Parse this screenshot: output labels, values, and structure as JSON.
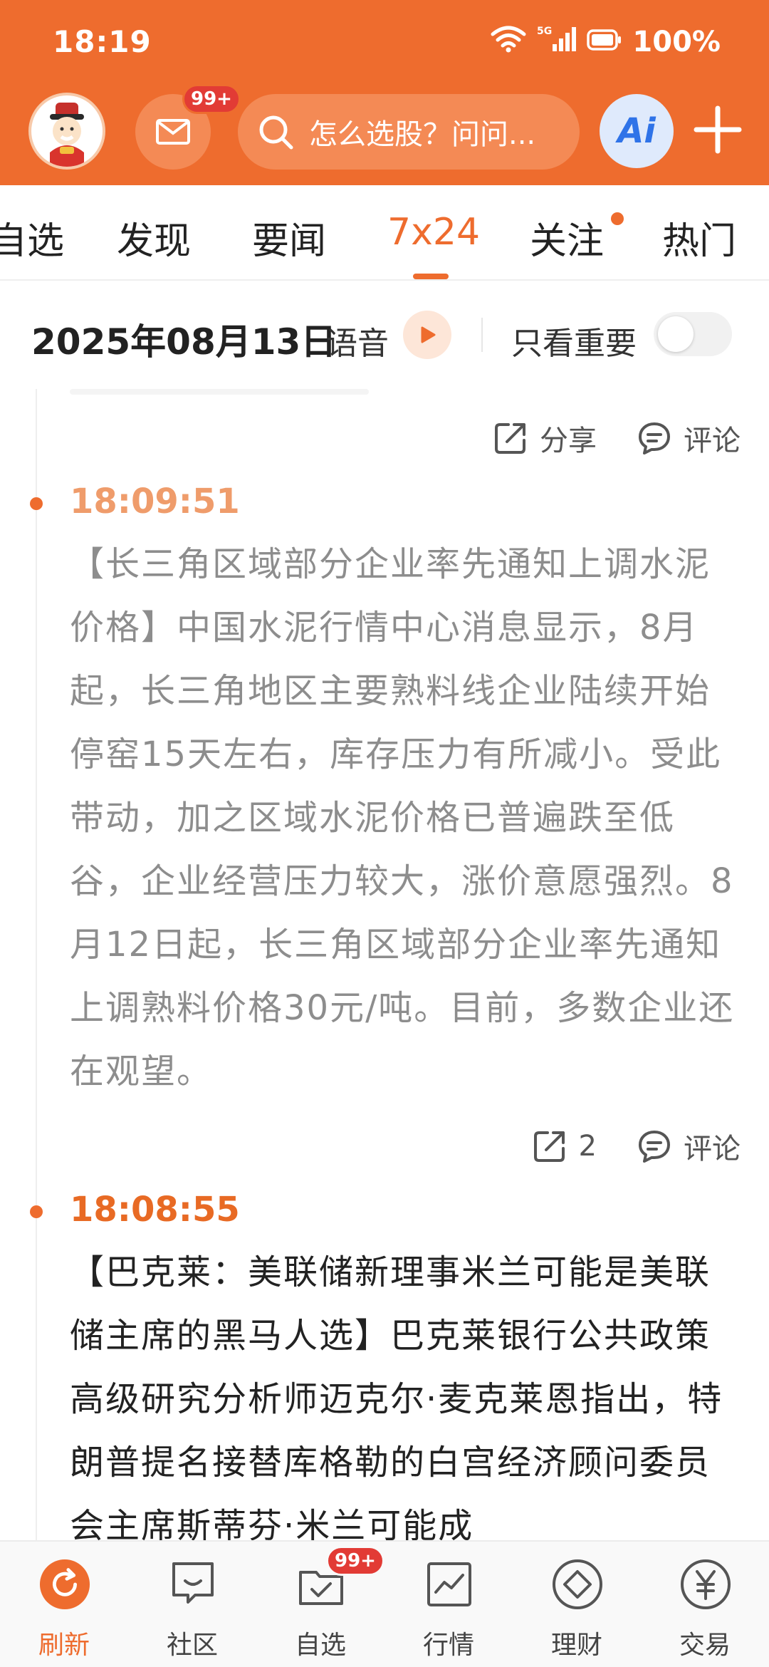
{
  "status_bar": {
    "time": "18:19",
    "network": "5G",
    "battery": "100%"
  },
  "header": {
    "mail_badge": "99+",
    "search_placeholder": "怎么选股？问问...",
    "ai_label": "Ai"
  },
  "tabs": [
    {
      "label": "自选",
      "active": false
    },
    {
      "label": "发现",
      "active": false
    },
    {
      "label": "要闻",
      "active": false
    },
    {
      "label": "7x24",
      "active": true
    },
    {
      "label": "关注",
      "active": false,
      "dot": true
    },
    {
      "label": "热门",
      "active": false
    }
  ],
  "date_row": {
    "date": "2025年08月13日",
    "voice_label": "语音",
    "important_label": "只看重要",
    "important_on": false
  },
  "feed": {
    "top_actions": {
      "share": "分享",
      "comment": "评论"
    },
    "items": [
      {
        "time": "18:09:51",
        "text": "【长三角区域部分企业率先通知上调水泥价格】中国水泥行情中心消息显示，8月起，长三角地区主要熟料线企业陆续开始停窑15天左右，库存压力有所减小。受此带动，加之区域水泥价格已普遍跌至低谷，企业经营压力较大，涨价意愿强烈。8月12日起，长三角区域部分企业率先通知上调熟料价格30元/吨。目前，多数企业还在观望。",
        "share_count": "2",
        "comment": "评论"
      },
      {
        "time": "18:08:55",
        "text": "【巴克莱：美联储新理事米兰可能是美联储主席的黑马人选】巴克莱银行公共政策高级研究分析师迈克尔·麦克莱恩指出，特朗普提名接替库格勒的白宫经济顾问委员会主席斯蒂芬·米兰可能成"
      }
    ]
  },
  "bottom_nav": [
    {
      "label": "刷新",
      "icon": "refresh-icon",
      "active": true
    },
    {
      "label": "社区",
      "icon": "chat-icon",
      "active": false
    },
    {
      "label": "自选",
      "icon": "watchlist-icon",
      "active": false,
      "badge": "99+"
    },
    {
      "label": "行情",
      "icon": "chart-icon",
      "active": false
    },
    {
      "label": "理财",
      "icon": "diamond-icon",
      "active": false
    },
    {
      "label": "交易",
      "icon": "yen-icon",
      "active": false
    }
  ],
  "colors": {
    "accent": "#ee6c2e",
    "read_text": "#8d8d8d",
    "badge": "#e23b35"
  }
}
